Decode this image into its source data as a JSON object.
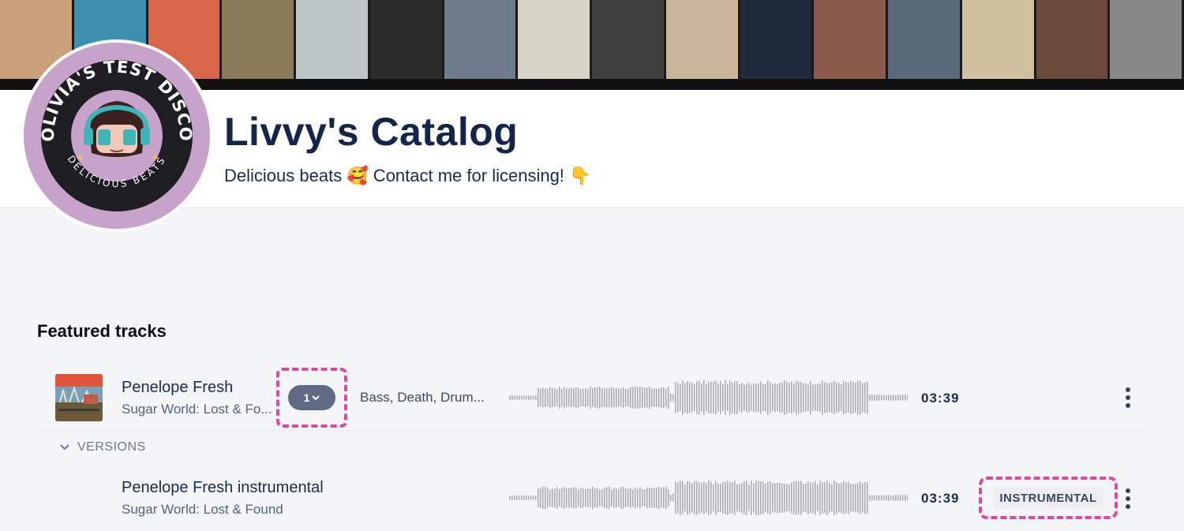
{
  "banner": {
    "strip_colors": [
      "#c9a07a",
      "#3d8fb0",
      "#d8654a",
      "#8a7a5a",
      "#bfc6c8",
      "#2b2b2b",
      "#6e7b8a",
      "#d9d4c8",
      "#3f3f3f",
      "#c9b59a",
      "#1f2a3a",
      "#8a5a4a",
      "#5a6a7a",
      "#d0c0a0",
      "#6a4a3a",
      "#888888"
    ]
  },
  "profile": {
    "title": "Livvy's Catalog",
    "subtitle": "Delicious beats 🥰 Contact me for licensing! 👇",
    "avatar": {
      "ring_top": "OLIVIA'S TEST DISCO",
      "ring_bottom": "DELICIOUS BEATS",
      "ring_color": "#c7a3cc"
    }
  },
  "featured": {
    "heading": "Featured tracks",
    "tracks": [
      {
        "title": "Penelope Fresh",
        "album": "Sugar World: Lost & Fo...",
        "version_count": "1",
        "tags": "Bass, Death, Drum...",
        "duration": "03:39"
      }
    ],
    "versions_label": "VERSIONS",
    "versions": [
      {
        "title": "Penelope Fresh instrumental",
        "album": "Sugar World: Lost & Found",
        "duration": "03:39",
        "badge": "INSTRUMENTAL"
      }
    ]
  },
  "colors": {
    "accent_dash": "#e0479e",
    "pill": "#5e6b83",
    "wave": "#a9a9a9",
    "title": "#15254a"
  },
  "icons": [
    "chevron-down-icon",
    "more-vertical-icon",
    "album-cover-image"
  ]
}
